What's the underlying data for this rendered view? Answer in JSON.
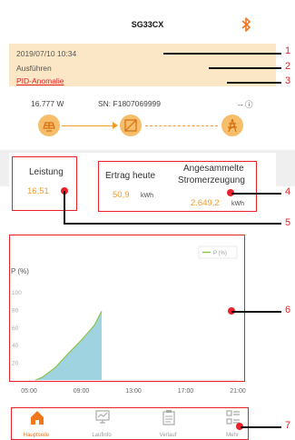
{
  "header": {
    "title": "SG33CX",
    "bluetooth_icon": "bluetooth-icon"
  },
  "status": {
    "datetime": "2019/07/10 10:34",
    "state": "Ausführen",
    "fault": "PID-Anomalie"
  },
  "flow": {
    "power": "16.777  W",
    "serial": "SN: F1807069999",
    "grid_value": "-- ⓘ",
    "icons": [
      "pv-panel-icon",
      "inverter-icon",
      "grid-tower-icon"
    ]
  },
  "stats": {
    "leistung": {
      "label": "Leistung",
      "value": "16,51"
    },
    "ertrag": {
      "label": "Ertrag heute",
      "value": "50,9",
      "unit": "kWh"
    },
    "gesamt": {
      "label_line1": "Angesammelte",
      "label_line2": "Stromerzeugung",
      "value": "2.649,2",
      "unit": "kWh"
    }
  },
  "callouts": [
    "1",
    "2",
    "3",
    "4",
    "5",
    "6",
    "7"
  ],
  "chart_data": {
    "type": "area",
    "ylabel": "P (%)",
    "legend": "P (%)",
    "x_ticks": [
      "05:00",
      "09:00",
      "13:00",
      "17:00",
      "21:00"
    ],
    "y_ticks": [
      "100",
      "80",
      "60",
      "40",
      "20"
    ],
    "ylim": [
      0,
      100
    ],
    "color": "#9fd3e0",
    "line_color": "#8bc34a",
    "x": [
      "05:30",
      "06:00",
      "07:00",
      "08:00",
      "09:00",
      "10:00",
      "10:34"
    ],
    "values": [
      0,
      3,
      14,
      30,
      45,
      62,
      78
    ]
  },
  "nav": [
    {
      "label": "Hauptseite",
      "icon": "home-icon",
      "active": true
    },
    {
      "label": "Laufinfo",
      "icon": "monitor-icon",
      "active": false
    },
    {
      "label": "Verlauf",
      "icon": "clipboard-icon",
      "active": false
    },
    {
      "label": "Mehr",
      "icon": "more-icon",
      "active": false
    }
  ]
}
